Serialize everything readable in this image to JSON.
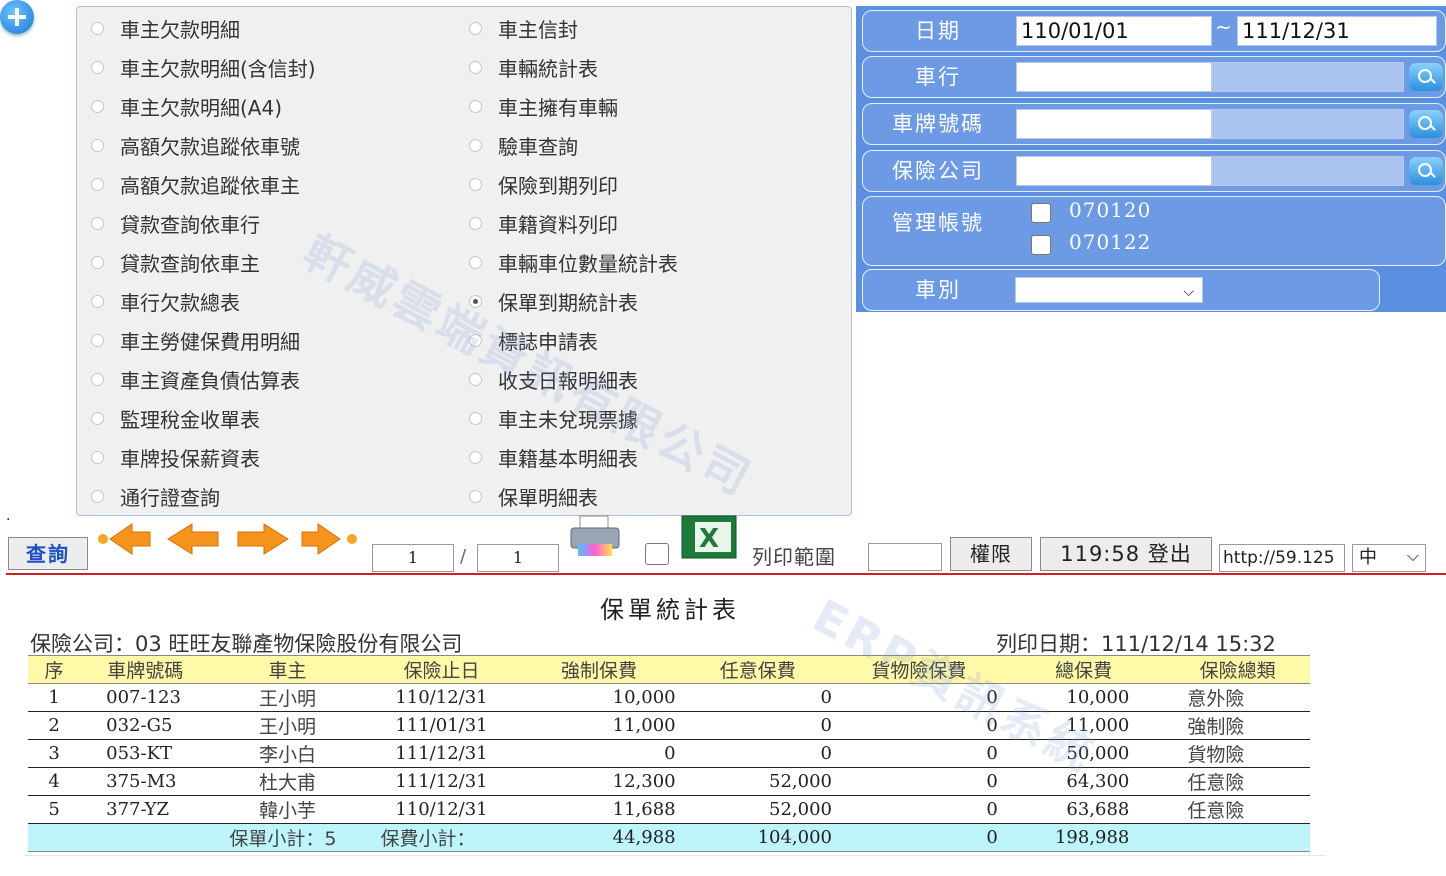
{
  "report_list": {
    "left_column": [
      "車主欠款明細",
      "車主欠款明細(含信封)",
      "車主欠款明細(A4)",
      "高額欠款追蹤依車號",
      "高額欠款追蹤依車主",
      "貸款查詢依車行",
      "貸款查詢依車主",
      "車行欠款總表",
      "車主勞健保費用明細",
      "車主資產負債估算表",
      "監理稅金收單表",
      "車牌投保薪資表",
      "通行證查詢"
    ],
    "right_column": [
      "車主信封",
      "車輛統計表",
      "車主擁有車輛",
      "驗車查詢",
      "保險到期列印",
      "車籍資料列印",
      "車輛車位數量統計表",
      "保單到期統計表",
      "標誌申請表",
      "收支日報明細表",
      "車主未兌現票據",
      "車籍基本明細表",
      "保單明細表"
    ],
    "selected": "保單到期統計表"
  },
  "filters": {
    "date_label": "日期",
    "date_from": "110/01/01",
    "date_sep": "~",
    "date_to": "111/12/31",
    "dealer_label": "車行",
    "plate_label": "車牌號碼",
    "insurer_label": "保險公司",
    "account_label": "管理帳號",
    "accounts": [
      "070120",
      "070122"
    ],
    "vehicle_type_label": "車別"
  },
  "toolbar": {
    "query_label": "查詢",
    "page_current": "1",
    "page_sep": "/",
    "page_total": "1",
    "print_range_label": "列印範圍",
    "permission_label": "權限",
    "logout_label": "119:58 登出",
    "url_text": "http://59.125",
    "lang_value": "中"
  },
  "report": {
    "title": "保單統計表",
    "insurer_line": "保險公司：03  旺旺友聯產物保險股份有限公司",
    "print_date": "列印日期：111/12/14 15:32",
    "columns": [
      "序",
      "車牌號碼",
      "車主",
      "保險止日",
      "強制保費",
      "任意保費",
      "貨物險保費",
      "總保費",
      "保險總類"
    ],
    "rows": [
      [
        "1",
        "007-123",
        "王小明",
        "110/12/31",
        "10,000",
        "0",
        "0",
        "10,000",
        "意外險"
      ],
      [
        "2",
        "032-G5",
        "王小明",
        "111/01/31",
        "11,000",
        "0",
        "0",
        "11,000",
        "強制險"
      ],
      [
        "3",
        "053-KT",
        "李小白",
        "111/12/31",
        "0",
        "0",
        "0",
        "50,000",
        "貨物險"
      ],
      [
        "4",
        "375-M3",
        "杜大甫",
        "111/12/31",
        "12,300",
        "52,000",
        "0",
        "64,300",
        "任意險"
      ],
      [
        "5",
        "377-YZ",
        "韓小芋",
        "110/12/31",
        "11,688",
        "52,000",
        "0",
        "63,688",
        "任意險"
      ]
    ],
    "summary": {
      "count_label": "保單小計：5",
      "fee_label": "保費小計：",
      "compulsory": "44,988",
      "optional": "104,000",
      "cargo": "0",
      "total": "198,988"
    }
  },
  "watermarks": [
    "軒威雲端資訊有限公司",
    "ERP資訊系統"
  ]
}
